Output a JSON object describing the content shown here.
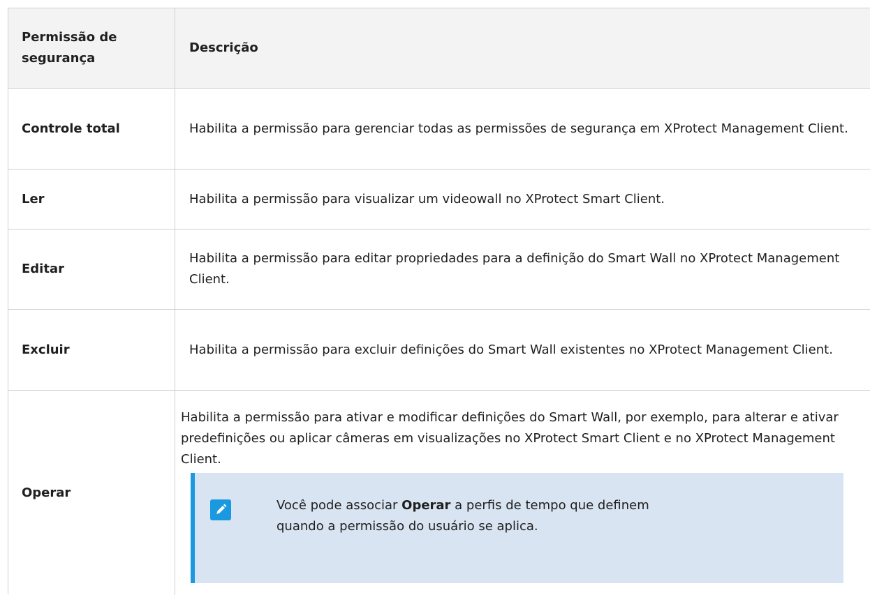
{
  "table": {
    "header": {
      "col1": "Permissão de segurança",
      "col2": "Descrição"
    },
    "rows": [
      {
        "permission": "Controle total",
        "description": "Habilita a permissão para gerenciar todas as permissões de segurança em XProtect Management Client."
      },
      {
        "permission": "Ler",
        "description": "Habilita a permissão para visualizar um videowall no XProtect Smart Client."
      },
      {
        "permission": "Editar",
        "description": "Habilita a permissão para editar propriedades para a definição do Smart Wall no XProtect Management Client."
      },
      {
        "permission": "Excluir",
        "description": "Habilita a permissão para excluir definições do Smart Wall existentes no XProtect Management Client."
      },
      {
        "permission": "Operar",
        "description": "Habilita a permissão para ativar e modificar definições do Smart Wall, por exemplo, para alterar e ativar predefinições ou aplicar câmeras em visualizações no XProtect Smart Client e no XProtect Management Client."
      }
    ]
  },
  "note": {
    "icon": "pencil-note-icon",
    "prefix": "Você pode associar ",
    "bold": "Operar",
    "suffix": " a perfis de tempo que definem quando a permissão do usuário se aplica."
  },
  "colors": {
    "accent": "#1a98e0",
    "note_bg": "#d9e4f2",
    "header_bg": "#f3f3f3",
    "border": "#d0d0d0"
  }
}
